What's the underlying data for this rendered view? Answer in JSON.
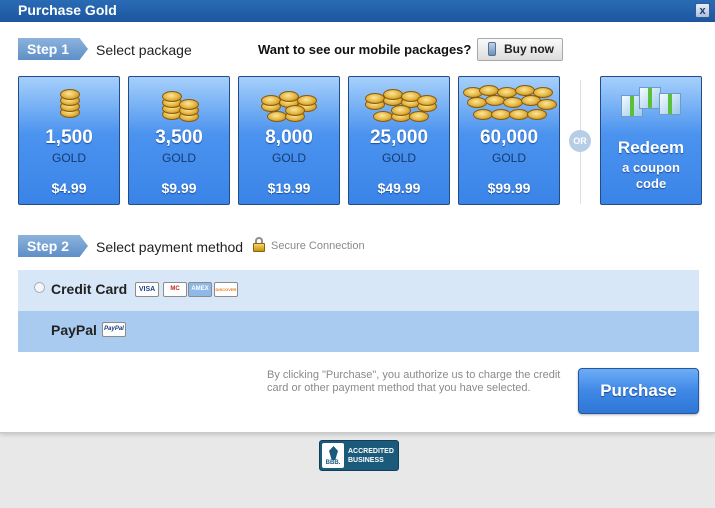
{
  "window": {
    "title": "Purchase Gold",
    "close_label": "x"
  },
  "step1": {
    "badge": "Step 1",
    "text": "Select package"
  },
  "mobile": {
    "question": "Want to see our mobile packages?",
    "button": "Buy now"
  },
  "packages": [
    {
      "amount": "1,500",
      "unit": "GOLD",
      "price": "$4.99"
    },
    {
      "amount": "3,500",
      "unit": "GOLD",
      "price": "$9.99"
    },
    {
      "amount": "8,000",
      "unit": "GOLD",
      "price": "$19.99"
    },
    {
      "amount": "25,000",
      "unit": "GOLD",
      "price": "$49.99"
    },
    {
      "amount": "60,000",
      "unit": "GOLD",
      "price": "$99.99"
    }
  ],
  "or_label": "OR",
  "redeem": {
    "line1": "Redeem",
    "line2": "a coupon",
    "line3": "code"
  },
  "step2": {
    "badge": "Step 2",
    "text": "Select payment method",
    "secure": "Secure Connection"
  },
  "payment": {
    "credit_card": {
      "label": "Credit Card",
      "cards": [
        "VISA",
        "MC",
        "AMEX",
        "DISCOVER"
      ]
    },
    "paypal": {
      "label": "PayPal",
      "logo": "PayPal"
    }
  },
  "legal": "By clicking \"Purchase\", you authorize us to charge the credit card or other payment method that you have selected.",
  "purchase_button": "Purchase",
  "bbb": {
    "line1": "ACCREDITED",
    "line2": "BUSINESS",
    "seal": "BBB."
  },
  "colors": {
    "titlebar": "#1c56a0",
    "package_blue": "#3a84e8",
    "cc_row": "#d7e7f7",
    "paypal_row": "#a9cbef"
  },
  "icons": [
    "close-icon",
    "phone-icon",
    "gold-coins-icon",
    "gift-boxes-icon",
    "lock-icon",
    "visa-icon",
    "mastercard-icon",
    "amex-icon",
    "discover-icon",
    "paypal-icon",
    "bbb-logo"
  ]
}
